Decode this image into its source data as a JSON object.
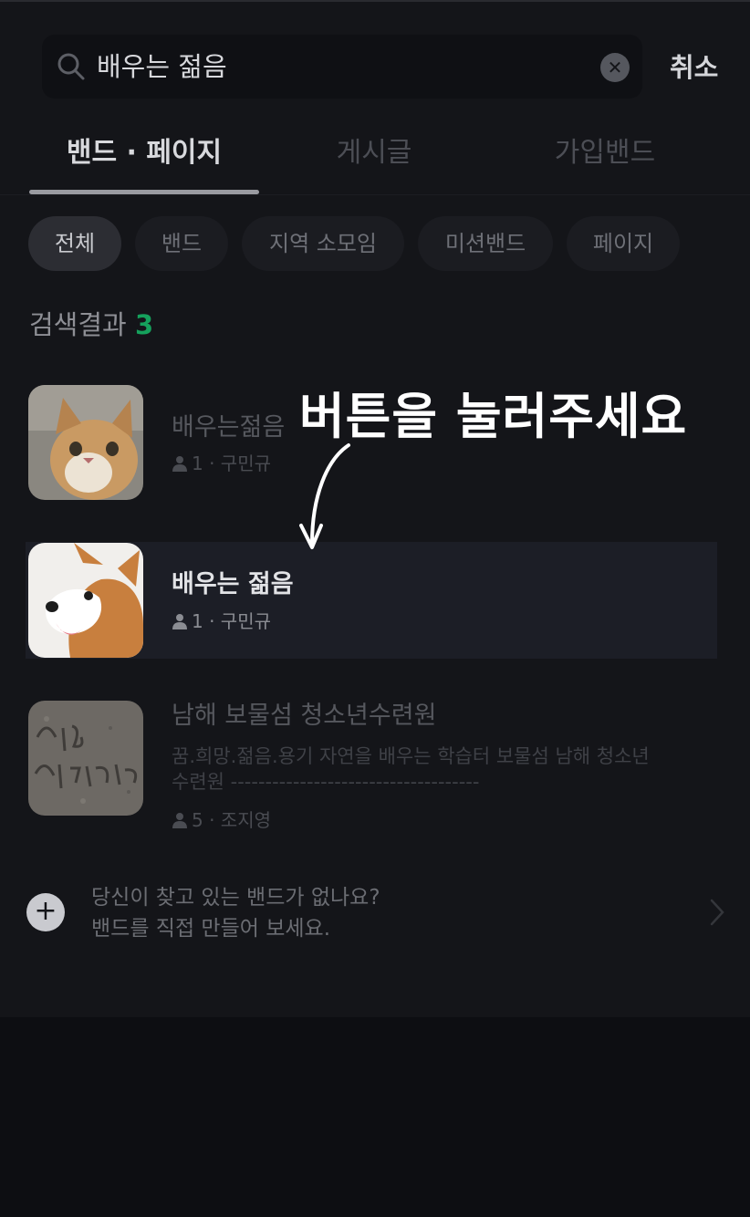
{
  "search": {
    "value": "배우는 젊음",
    "cancel_label": "취소"
  },
  "tabs": [
    {
      "label": "밴드 · 페이지"
    },
    {
      "label": "게시글"
    },
    {
      "label": "가입밴드"
    }
  ],
  "filters": [
    {
      "label": "전체"
    },
    {
      "label": "밴드"
    },
    {
      "label": "지역 소모임"
    },
    {
      "label": "미션밴드"
    },
    {
      "label": "페이지"
    }
  ],
  "results_header": {
    "label": "검색결과",
    "count": "3"
  },
  "results": [
    {
      "title": "배우는젊음",
      "meta": "1 · 구민규"
    },
    {
      "title": "배우는 젊음",
      "meta": "1 · 구민규"
    },
    {
      "title": "남해 보물섬 청소년수련원",
      "desc1": "꿈.희망.젊음.용기 자연을 배우는 학습터 보물섬 남해 청소년",
      "desc2": "수련원 ------------------------------------",
      "meta": "5 · 조지영"
    }
  ],
  "overlay": {
    "text": "버튼을 눌러주세요"
  },
  "create_band": {
    "line1": "당신이 찾고 있는 밴드가 없나요?",
    "line2": "밴드를 직접 만들어 보세요."
  },
  "colors": {
    "accent_green": "#15a15c",
    "background": "#141519",
    "highlight": "#1c1e26"
  }
}
